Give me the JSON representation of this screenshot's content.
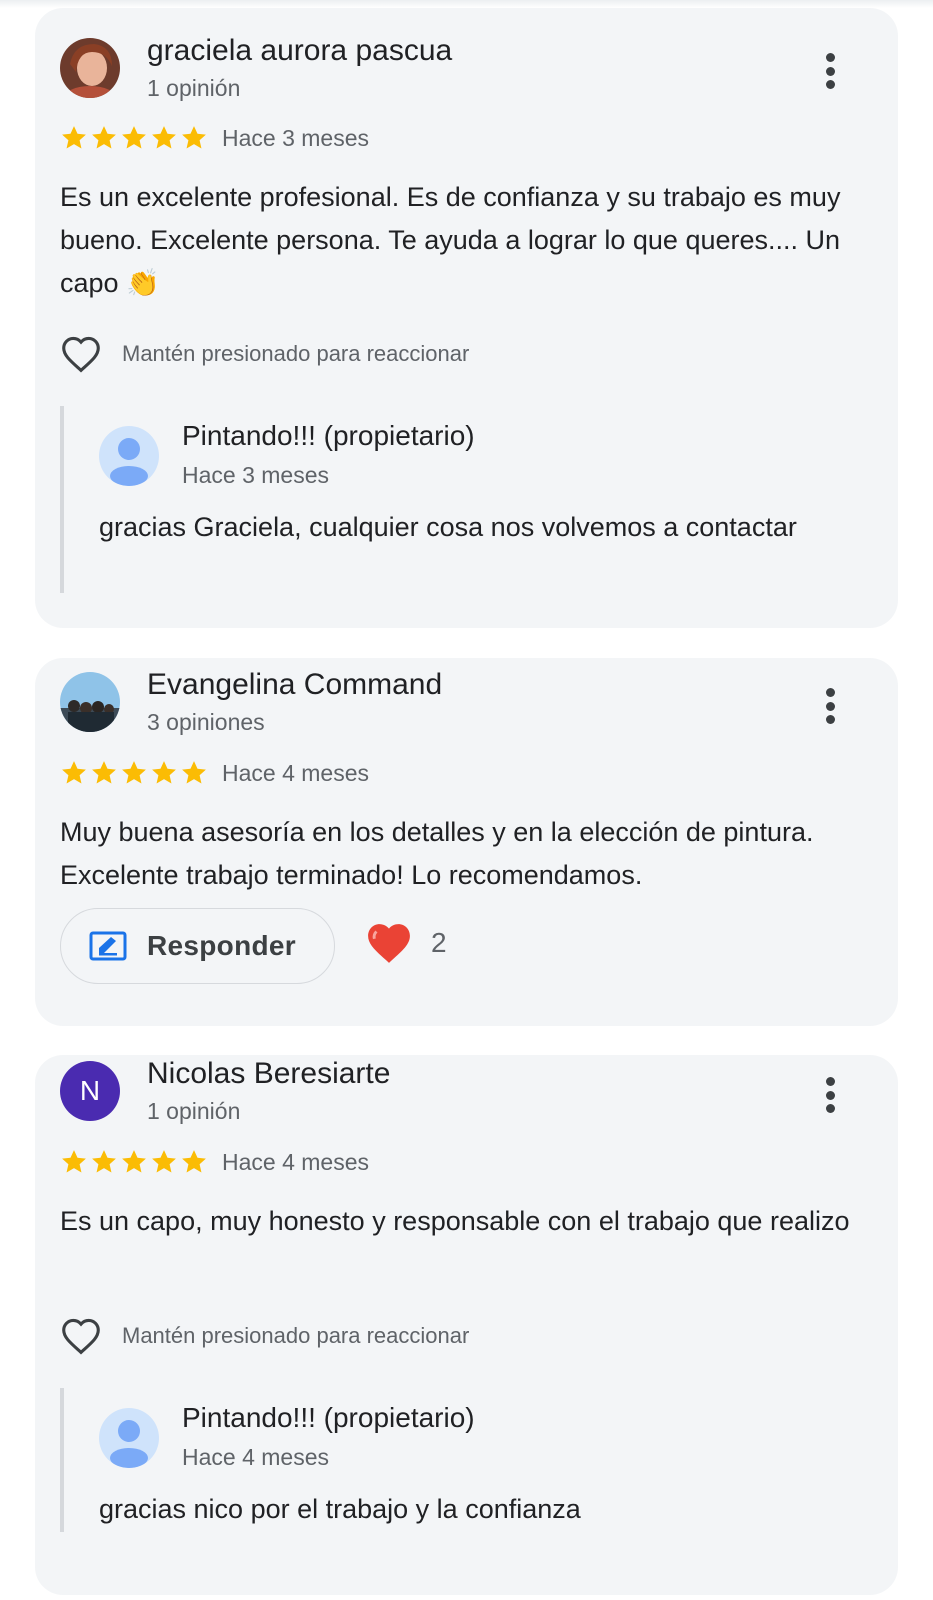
{
  "reviews": [
    {
      "author": "graciela aurora pascua",
      "count": "1 opinión",
      "rating": 5,
      "date": "Hace 3 meses",
      "text": "Es un excelente profesional. Es de confianza y su trabajo es muy bueno. Excelente persona. Te ayuda a lograr lo que queres.... Un capo 👏",
      "react_label": "Mantén presionado para reaccionar",
      "reply": {
        "author": "Pintando!!! (propietario)",
        "date": "Hace 3 meses",
        "text": "gracias Graciela, cualquier cosa nos volvemos a contactar"
      }
    },
    {
      "author": "Evangelina Command",
      "count": "3 opiniones",
      "rating": 5,
      "date": "Hace 4 meses",
      "text": "Muy buena asesoría en los detalles y en la elección de pintura. Excelente trabajo terminado! Lo recomendamos.",
      "respond_label": "Responder",
      "reactions": "2"
    },
    {
      "author": "Nicolas Beresiarte",
      "count": "1 opinión",
      "avatar_letter": "N",
      "rating": 5,
      "date": "Hace 4 meses",
      "text": "Es un capo, muy honesto y responsable con el trabajo que realizo",
      "react_label": "Mantén presionado para reaccionar",
      "reply": {
        "author": "Pintando!!! (propietario)",
        "date": "Hace 4 meses",
        "text": "gracias nico por el trabajo y la confianza"
      }
    }
  ],
  "colors": {
    "star": "#fbbc04",
    "card_bg": "#f3f5f7",
    "avatar_letter_bg": "#4a2bb0",
    "owner_avatar": "#7baaf7",
    "heart": "#ea4335"
  }
}
